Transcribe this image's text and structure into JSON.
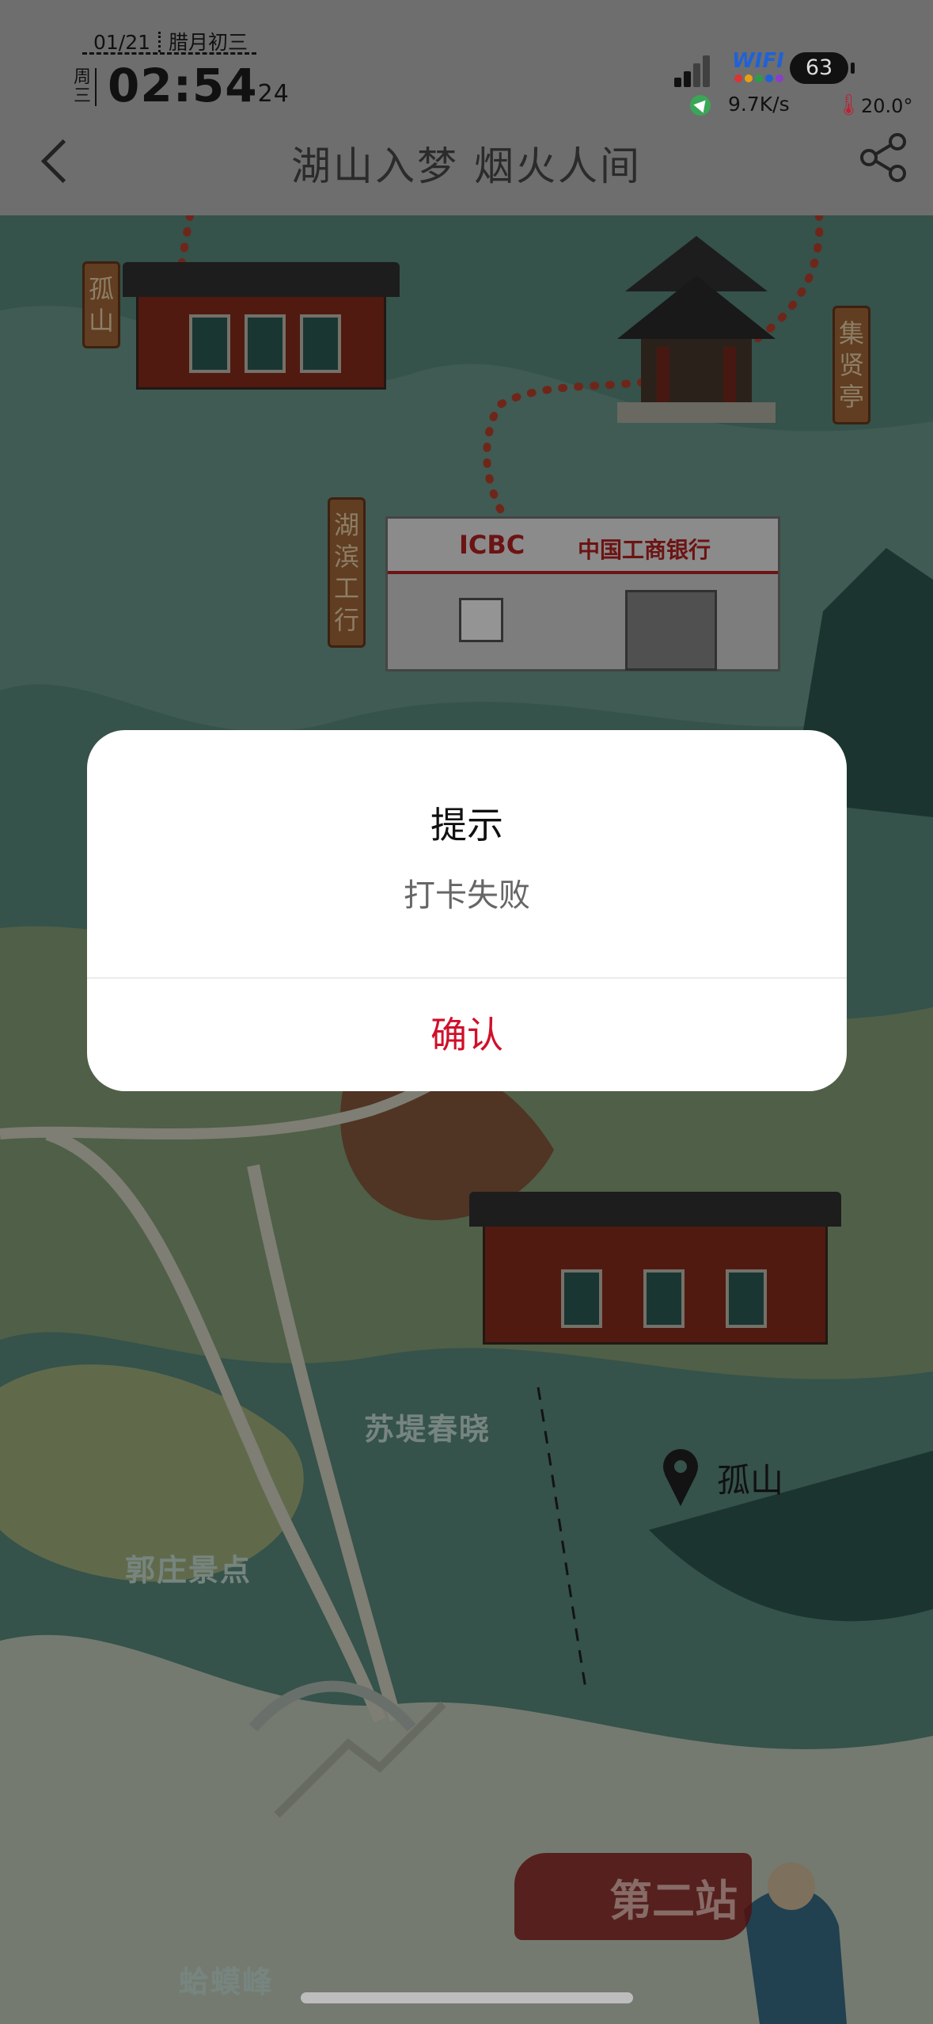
{
  "status_bar": {
    "date": "01/21",
    "lunar_date": "腊月初三",
    "weekday": "周三",
    "time": "02:54",
    "seconds": "24",
    "wifi_label": "WIFI",
    "battery": "63",
    "net_speed": "9.7K/s",
    "temperature": "20.0°"
  },
  "nav": {
    "title": "湖山入梦 烟火人间",
    "back_icon": "chevron-left-icon",
    "share_icon": "share-icon"
  },
  "map": {
    "labels": {
      "gushan_sign": "孤山",
      "jixianting_sign": "集贤亭",
      "hubin_sign": "湖滨工行",
      "icbc_en": "ICBC",
      "icbc_cn": "中国工商银行",
      "sudi": "苏堤春晓",
      "guozhuang": "郭庄景点",
      "hamafeng": "蛤蟆峰",
      "pin_gushan": "孤山",
      "station": "第二站"
    }
  },
  "dialog": {
    "title": "提示",
    "message": "打卡失败",
    "confirm_label": "确认",
    "accent_color": "#d0102a"
  }
}
